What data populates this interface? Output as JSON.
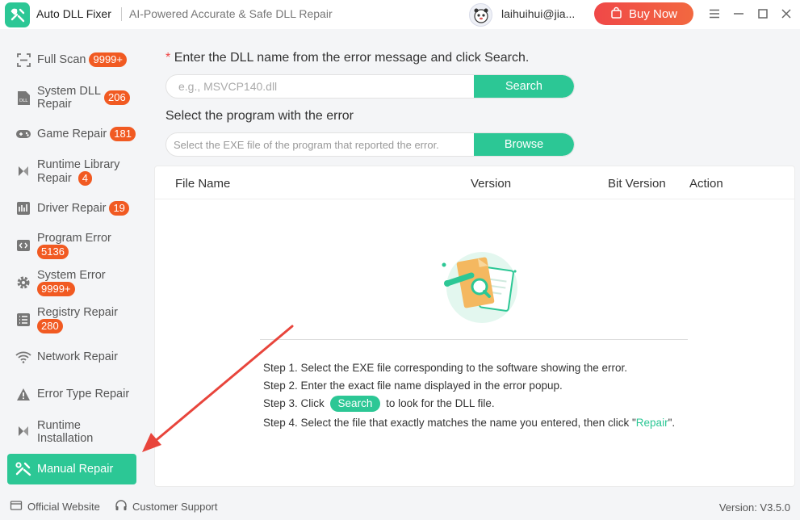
{
  "header": {
    "app_title": "Auto DLL Fixer",
    "app_subtitle": "AI-Powered Accurate & Safe DLL Repair",
    "user_email": "laihuihui@jia...",
    "buy_label": "Buy Now"
  },
  "sidebar": {
    "items": [
      {
        "label": "Full Scan",
        "badge": "9999+",
        "icon": "scan-icon"
      },
      {
        "label": "System DLL Repair",
        "badge": "206",
        "icon": "dll-icon"
      },
      {
        "label": "Game Repair",
        "badge": "181",
        "icon": "gamepad-icon"
      },
      {
        "label": "Runtime Library Repair",
        "badge": "4",
        "icon": "runtime-library-icon"
      },
      {
        "label": "Driver Repair",
        "badge": "19",
        "icon": "driver-icon"
      },
      {
        "label": "Program Error",
        "badge": "5136",
        "icon": "code-icon"
      },
      {
        "label": "System Error",
        "badge": "9999+",
        "icon": "gear-icon"
      },
      {
        "label": "Registry Repair",
        "badge": "280",
        "icon": "registry-icon"
      },
      {
        "label": "Network Repair",
        "badge": "",
        "icon": "wifi-icon"
      },
      {
        "label": "Error Type Repair",
        "badge": "",
        "icon": "warning-icon"
      },
      {
        "label": "Runtime Installation",
        "badge": "",
        "icon": "install-icon"
      },
      {
        "label": "Manual Repair",
        "badge": "",
        "icon": "wrench-icon"
      }
    ]
  },
  "main": {
    "dll_prompt_star": "*",
    "dll_prompt": "Enter the DLL name from the error message and click Search.",
    "dll_placeholder": "e.g., MSVCP140.dll",
    "search_label": "Search",
    "program_prompt": "Select the program with the error",
    "exe_placeholder": "Select the EXE file of the program that reported the error.",
    "browse_label": "Browse",
    "table": {
      "columns": [
        "File Name",
        "Version",
        "Bit Version",
        "Action"
      ]
    },
    "steps": {
      "step1": "Step 1. Select the EXE file corresponding to the software showing the error.",
      "step2": "Step 2. Enter the exact file name displayed in the error popup.",
      "step3_prefix": "Step 3. Click",
      "step3_button": "Search",
      "step3_suffix": "to look for the DLL file.",
      "step4_prefix": "Step 4. Select the file that exactly matches the name you entered, then click \"",
      "step4_link": "Repair",
      "step4_suffix": "\"."
    }
  },
  "footer": {
    "official_website": "Official Website",
    "customer_support": "Customer Support",
    "version": "Version: V3.5.0"
  },
  "colors": {
    "accent": "#2cc795",
    "badge": "#f15a22",
    "buy": "#f04848",
    "annotation_arrow": "#e8453c"
  }
}
